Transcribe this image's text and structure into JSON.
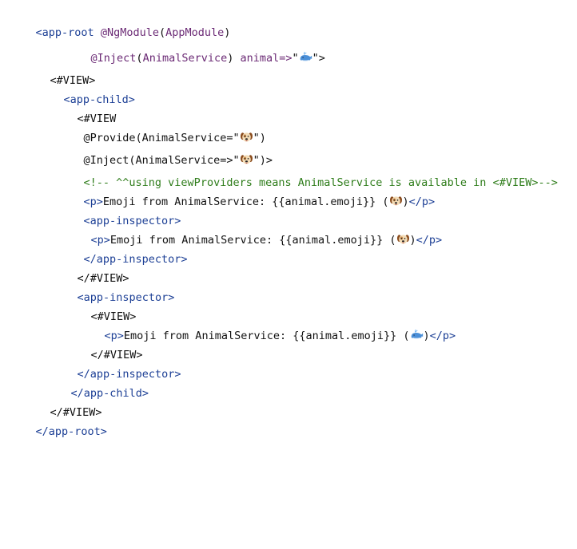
{
  "code": {
    "l1": {
      "open": "<app-root",
      "dec": "@NgModule",
      "lp": "(",
      "cls": "AppModule",
      "rp": ")"
    },
    "l2": {
      "dec": "@Inject",
      "lp": "(",
      "cls": "AnimalService",
      "rp": ")",
      "attr": " animal=>",
      "q1": "\"",
      "emoji": "whale-emoji",
      "q2": "\">"
    },
    "l3": {
      "text": "<#VIEW>"
    },
    "l4": {
      "tag": "<app-child>"
    },
    "l5": {
      "text": "<#VIEW"
    },
    "l6": {
      "pre": "@Provide(AnimalService=\"",
      "emoji": "dog-emoji",
      "post": "\")"
    },
    "l7": {
      "pre": "@Inject(AnimalService=>\"",
      "emoji": "dog-emoji",
      "post": "\")>"
    },
    "l8": {
      "comment": "<!-- ^^using viewProviders means AnimalService is available in <#VIEW>-->"
    },
    "l9": {
      "open": "<p>",
      "text": "Emoji from AnimalService: {{animal.emoji}} (",
      "emoji": "dog-emoji",
      "close_paren": ")",
      "close": "</p>"
    },
    "l10": {
      "tag": "<app-inspector>"
    },
    "l11": {
      "open": "<p>",
      "text": "Emoji from AnimalService: {{animal.emoji}} (",
      "emoji": "dog-emoji",
      "close_paren": ")",
      "close": "</p>"
    },
    "l12": {
      "tag": "</app-inspector>"
    },
    "l13": {
      "text": "</#VIEW>"
    },
    "l14": {
      "tag": "<app-inspector>"
    },
    "l15": {
      "text": "<#VIEW>"
    },
    "l16": {
      "open": "<p>",
      "text": "Emoji from AnimalService: {{animal.emoji}} (",
      "emoji": "whale-emoji",
      "close_paren": ")",
      "close": "</p>"
    },
    "l17": {
      "text": "</#VIEW>"
    },
    "l18": {
      "tag": "</app-inspector>"
    },
    "l19": {
      "tag": "</app-child>"
    },
    "l20": {
      "text": "</#VIEW>"
    },
    "l21": {
      "tag": "</app-root>"
    }
  }
}
